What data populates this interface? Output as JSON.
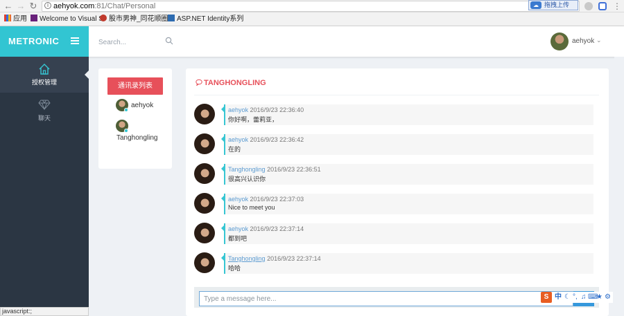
{
  "browser": {
    "url_host": "aehyok.com",
    "url_path": ":81/Chat/Personal",
    "upload_label": "拖拽上传",
    "bookmarks": [
      {
        "label": "应用"
      },
      {
        "label": "Welcome to Visual S"
      },
      {
        "label": "股市男神_同花顺圈子"
      },
      {
        "label": "ASP.NET Identity系列"
      }
    ],
    "status_text": "javascript:;"
  },
  "header": {
    "brand": "METRONIC",
    "search_placeholder": "Search...",
    "user_name": "aehyok"
  },
  "sidebar": {
    "items": [
      {
        "label": "授权管理",
        "icon": "home-icon"
      },
      {
        "label": "聊天",
        "icon": "diamond-icon"
      }
    ]
  },
  "contacts": {
    "button_label": "通讯录列表",
    "list": [
      {
        "name": "aehyok",
        "online": true
      },
      {
        "name": "Tanghongling",
        "online": true
      }
    ]
  },
  "chat": {
    "title": "TANGHONGLING",
    "messages": [
      {
        "sender": "aehyok",
        "time": "2016/9/23 22:36:40",
        "text": "你好啊，蕾莉亚，"
      },
      {
        "sender": "aehyok",
        "time": "2016/9/23 22:36:42",
        "text": "在的"
      },
      {
        "sender": "Tanghongling",
        "time": "2016/9/23 22:36:51",
        "text": "很高兴认识你"
      },
      {
        "sender": "aehyok",
        "time": "2016/9/23 22:37:03",
        "text": "Nice to meet you"
      },
      {
        "sender": "aehyok",
        "time": "2016/9/23 22:37:14",
        "text": "都到吧"
      },
      {
        "sender": "Tanghongling",
        "time": "2016/9/23 22:37:14",
        "text": "哈哈"
      }
    ],
    "compose_placeholder": "Type a message here..."
  },
  "ime": {
    "logo": "S",
    "mode": "中"
  },
  "colors": {
    "brand": "#32c5d2",
    "sidebar": "#2b3643",
    "accent_red": "#e7505a",
    "link_blue": "#5b9bd1",
    "send_blue": "#3598dc"
  }
}
